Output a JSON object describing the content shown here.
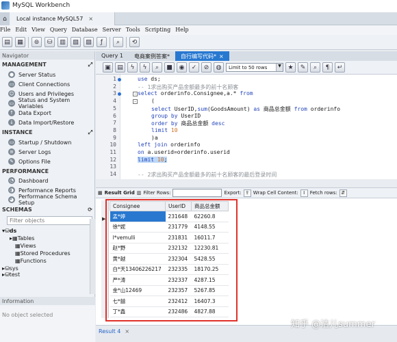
{
  "app": {
    "title": "MySQL Workbench",
    "instance_tab": "Local instance MySQL57"
  },
  "menu": [
    "File",
    "Edit",
    "View",
    "Query",
    "Database",
    "Server",
    "Tools",
    "Scripting",
    "Help"
  ],
  "navigator": {
    "header": "Navigator",
    "management": {
      "title": "MANAGEMENT",
      "items": [
        "Server Status",
        "Client Connections",
        "Users and Privileges",
        "Status and System Variables",
        "Data Export",
        "Data Import/Restore"
      ]
    },
    "instance": {
      "title": "INSTANCE",
      "items": [
        "Startup / Shutdown",
        "Server Logs",
        "Options File"
      ]
    },
    "performance": {
      "title": "PERFORMANCE",
      "items": [
        "Dashboard",
        "Performance Reports",
        "Performance Schema Setup"
      ]
    },
    "schemas": {
      "title": "SCHEMAS",
      "filter_placeholder": "Filter objects",
      "db": "ds",
      "children": [
        "Tables",
        "Views",
        "Stored Procedures",
        "Functions"
      ],
      "other": "sys",
      "other2": "test"
    }
  },
  "information": {
    "header": "Information",
    "body": "No object selected"
  },
  "query_tabs": [
    {
      "label": "Query 1"
    },
    {
      "label": "电商案例答案*"
    },
    {
      "label": "自行编写代码*",
      "active": true
    }
  ],
  "editor_toolbar": {
    "limit": "Limit to 50 rows"
  },
  "code_lines": [
    "use ds;",
    "-- 1求出购买产品金额最多的前十名顾客",
    "select orderinfo.Consignee,a.* from",
    "(",
    "select UserID,sum(GoodsAmount) as 商品总金额 from orderinfo",
    "group by UserID",
    "order by 商品总金额 desc",
    "limit 10",
    ")a",
    "left join orderinfo",
    "on a.userid=orderinfo.userid",
    "limit 10;",
    "",
    "-- 2求出购买产品金额最多的前十名顾客的最后登录时间"
  ],
  "result_toolbar": {
    "result_grid": "Result Grid",
    "filter_rows": "Filter Rows:",
    "export": "Export:",
    "wrap": "Wrap Cell Content:",
    "fetch": "Fetch rows:"
  },
  "result": {
    "columns": [
      "Consignee",
      "UserID",
      "商品总金额"
    ],
    "rows": [
      [
        "孟*婷",
        "231648",
        "62260.8"
      ],
      [
        "徐*妮",
        "231779",
        "4148.55"
      ],
      [
        "l*vemulli",
        "231831",
        "16011.7"
      ],
      [
        "赵*野",
        "232132",
        "12230.81"
      ],
      [
        "黄*越",
        "232304",
        "5428.55"
      ],
      [
        "白*天13406226217",
        "232335",
        "18170.25"
      ],
      [
        "严*涛",
        "232337",
        "4287.15"
      ],
      [
        "金*山12469",
        "232357",
        "5267.85"
      ],
      [
        "七*囍",
        "232412",
        "16407.3"
      ],
      [
        "丁*鑫",
        "232486",
        "4827.88"
      ]
    ]
  },
  "result_tab": "Result 4",
  "watermark": "知乎 @洁儿summer",
  "colors": {
    "accent": "#2878d0",
    "highlight_box": "#e0302a"
  }
}
